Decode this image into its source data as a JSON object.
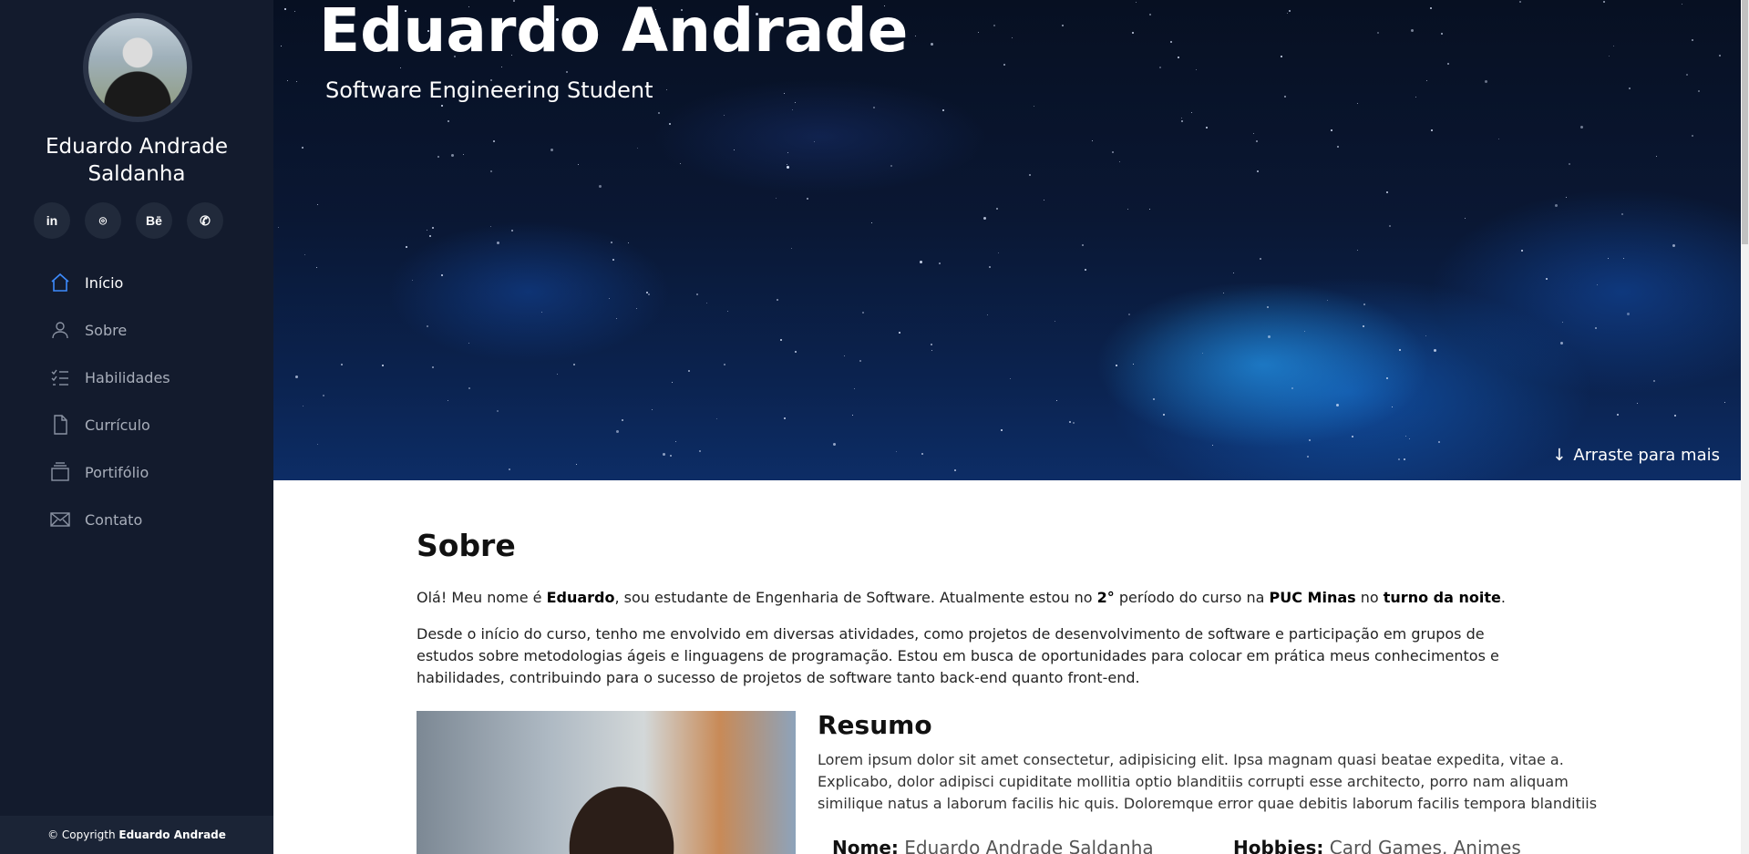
{
  "sidebar": {
    "name": "Eduardo Andrade Saldanha",
    "social": [
      {
        "icon": "linkedin-icon",
        "glyph": "in"
      },
      {
        "icon": "github-icon",
        "glyph": "⌾"
      },
      {
        "icon": "behance-icon",
        "glyph": "Bē"
      },
      {
        "icon": "whatsapp-icon",
        "glyph": "✆"
      }
    ],
    "nav": [
      {
        "label": "Início",
        "icon": "home-icon",
        "active": true
      },
      {
        "label": "Sobre",
        "icon": "user-icon"
      },
      {
        "label": "Habilidades",
        "icon": "list-check-icon"
      },
      {
        "label": "Currículo",
        "icon": "file-icon"
      },
      {
        "label": "Portifólio",
        "icon": "portfolio-icon"
      },
      {
        "label": "Contato",
        "icon": "envelope-icon"
      }
    ],
    "footer_prefix": "© Copyrigth",
    "footer_name": "Eduardo Andrade"
  },
  "hero": {
    "title": "Eduardo Andrade",
    "subtitle": "Software Engineering Student",
    "scroll_hint": "Arraste para mais",
    "accent": "#0d2d66"
  },
  "about": {
    "title": "Sobre",
    "p1_a": "Olá! Meu nome é ",
    "p1_name": "Eduardo",
    "p1_b": ", sou estudante de Engenharia de Software. Atualmente estou no ",
    "p1_period": "2°",
    "p1_c": " período do curso na ",
    "p1_school": "PUC Minas",
    "p1_d": " no ",
    "p1_shift": "turno da noite",
    "p1_e": ".",
    "p2": "Desde o início do curso, tenho me envolvido em diversas atividades, como projetos de desenvolvimento de software e participação em grupos de estudos sobre metodologias ágeis e linguagens de programação. Estou em busca de oportunidades para colocar em prática meus conhecimentos e habilidades, contribuindo para o sucesso de projetos de software tanto back-end quanto front-end.",
    "resume_title": "Resumo",
    "resume_text": "Lorem ipsum dolor sit amet consectetur, adipisicing elit. Ipsa magnam quasi beatae expedita, vitae a. Explicabo, dolor adipisci cupiditate mollitia optio blanditiis corrupti esse architecto, porro nam aliquam similique natus a laborum facilis hic quis. Doloremque error quae debitis laborum facilis tempora blanditiis",
    "info": [
      {
        "key": "Nome:",
        "value": "Eduardo Andrade Saldanha"
      },
      {
        "key": "Hobbies:",
        "value": "Card Games, Animes"
      }
    ]
  }
}
